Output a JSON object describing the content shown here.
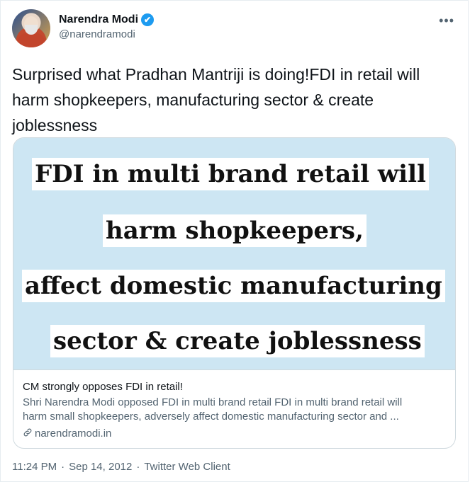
{
  "author": {
    "display_name": "Narendra Modi",
    "handle": "@narendramodi",
    "verified_badge": "✔",
    "more_label": "•••"
  },
  "tweet": {
    "text_line1": "Surprised what Pradhan Mantriji is doing!FDI in retail will",
    "text_line2": "harm shopkeepers, manufacturing sector & create",
    "text_line3": "joblessness"
  },
  "card": {
    "image_lines": [
      "FDI in multi brand retail will",
      "harm shopkeepers,",
      "affect domestic manufacturing",
      "sector & create joblessness"
    ],
    "title": "CM strongly opposes FDI in retail!",
    "description_line1": "Shri Narendra Modi opposed FDI in multi brand retail FDI in multi brand retail will",
    "description_line2": "harm small shopkeepers, adversely affect domestic manufacturing sector and ...",
    "domain": "narendramodi.in",
    "link_icon": "link-icon"
  },
  "meta": {
    "time": "11:24 PM",
    "sep1": "·",
    "date": "Sep 14, 2012",
    "sep2": "·",
    "client": "Twitter Web Client"
  },
  "colors": {
    "verified_blue": "#1d9bf0",
    "secondary_text": "#536471",
    "card_image_bg": "#cde6f3"
  }
}
